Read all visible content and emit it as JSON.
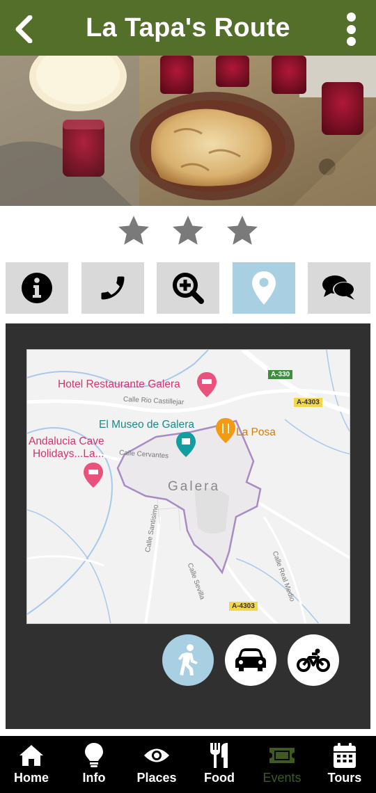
{
  "header": {
    "title": "La Tapa's Route",
    "back_icon": "chevron-left-icon",
    "menu_icon": "more-vertical-icon",
    "color": "#536f2a"
  },
  "rating": {
    "stars": 3,
    "color": "#7a7a7a"
  },
  "actions": [
    {
      "icon": "info-icon",
      "active": false
    },
    {
      "icon": "phone-icon",
      "active": false
    },
    {
      "icon": "zoom-in-icon",
      "active": false
    },
    {
      "icon": "map-pin-icon",
      "active": true
    },
    {
      "icon": "chat-icon",
      "active": false
    }
  ],
  "map": {
    "labels": {
      "hotel": "Hotel Restaurante Galera",
      "museum": "El Museo de Galera",
      "cave_line1": "Andalucia Cave",
      "cave_line2": "Holidays...La...",
      "posa": "La Posa",
      "town": "Galera",
      "street_castillejar": "Calle Rio Castillejar",
      "street_cervantes": "Calle Cervantes",
      "street_santisimo": "Calle Santisimo",
      "street_sevilla": "Calle Sevilla",
      "street_real_medio": "Calle Real Medio"
    },
    "roads": {
      "a330": "A-330",
      "a4303_top": "A-4303",
      "a4303_bottom": "A-4303"
    },
    "modes": [
      {
        "icon": "walking-icon",
        "active": true
      },
      {
        "icon": "car-icon",
        "active": false
      },
      {
        "icon": "bicycle-icon",
        "active": false
      }
    ]
  },
  "nav": {
    "items": [
      {
        "label": "Home",
        "icon": "home-icon",
        "active": false
      },
      {
        "label": "Info",
        "icon": "lightbulb-icon",
        "active": false
      },
      {
        "label": "Places",
        "icon": "eye-icon",
        "active": false
      },
      {
        "label": "Food",
        "icon": "utensils-icon",
        "active": false
      },
      {
        "label": "Events",
        "icon": "ticket-icon",
        "active": true
      },
      {
        "label": "Tours",
        "icon": "calendar-icon",
        "active": false
      }
    ],
    "active_color": "#3e5a1f"
  },
  "colors": {
    "accent_active": "#a9cfe2",
    "panel": "#303030",
    "tab": "#d9d9d9"
  }
}
